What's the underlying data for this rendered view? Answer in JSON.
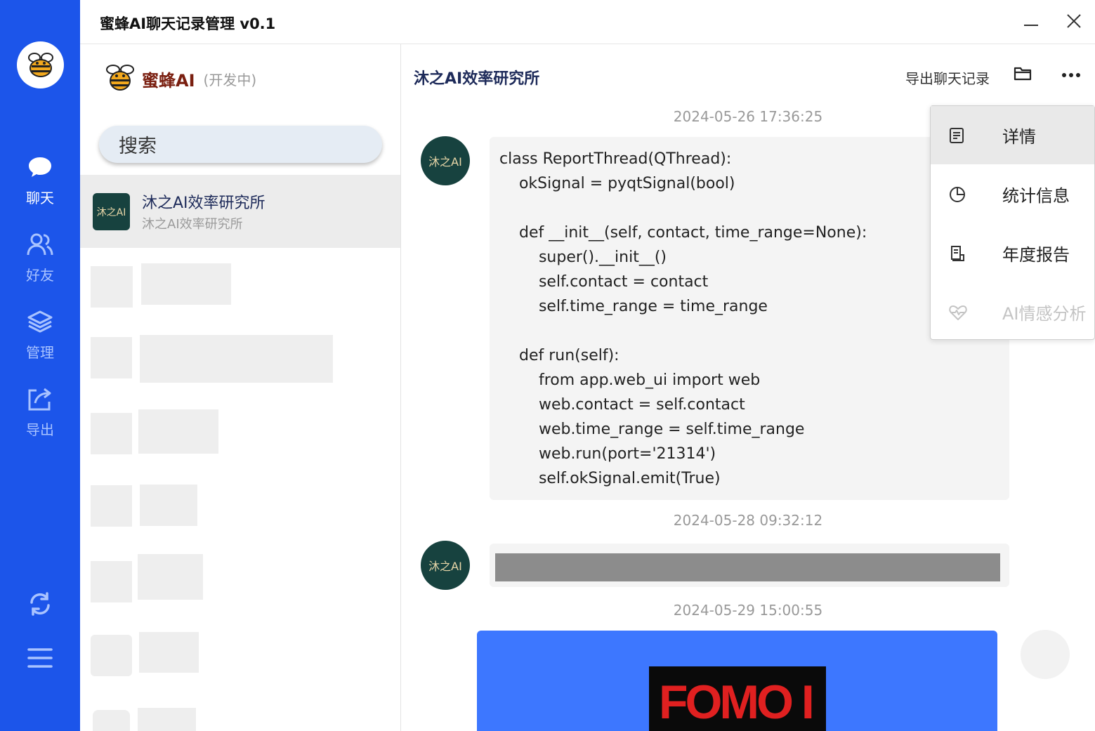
{
  "app": {
    "title": "蜜蜂AI聊天记录管理 v0.1"
  },
  "nav": {
    "items": [
      {
        "label": "聊天",
        "icon": "chat-bubble-icon"
      },
      {
        "label": "好友",
        "icon": "friends-icon"
      },
      {
        "label": "管理",
        "icon": "layers-icon"
      },
      {
        "label": "导出",
        "icon": "share-export-icon"
      }
    ],
    "bottom": [
      "refresh-icon",
      "menu-icon"
    ]
  },
  "brand": {
    "name": "蜜蜂AI",
    "status": "(开发中)"
  },
  "search": {
    "placeholder": "搜索"
  },
  "contacts": [
    {
      "name": "沐之AI效率研究所",
      "last_message": "沐之AI效率研究所",
      "avatar_text": "沐之AI"
    }
  ],
  "chat": {
    "contact_name": "沐之AI效率研究所",
    "export_label": "导出聊天记录",
    "messages": [
      {
        "time": "2024-05-26 17:36:25",
        "avatar_text": "沐之AI",
        "code": "class ReportThread(QThread):\n    okSignal = pyqtSignal(bool)\n\n    def __init__(self, contact, time_range=None):\n        super().__init__()\n        self.contact = contact\n        self.time_range = time_range\n\n    def run(self):\n        from app.web_ui import web\n        web.contact = self.contact\n        web.time_range = self.time_range\n        web.run(port='21314')\n        self.okSignal.emit(True)"
      },
      {
        "time": "2024-05-28 09:32:12",
        "avatar_text": "沐之AI"
      },
      {
        "time": "2024-05-29 15:00:55",
        "image_text": "FOMO I"
      }
    ]
  },
  "menu": {
    "items": [
      {
        "label": "详情",
        "icon": "document-icon",
        "state": "hover"
      },
      {
        "label": "统计信息",
        "icon": "pie-chart-icon",
        "state": "normal"
      },
      {
        "label": "年度报告",
        "icon": "report-icon",
        "state": "normal"
      },
      {
        "label": "AI情感分析",
        "icon": "heart-pulse-icon",
        "state": "disabled"
      }
    ]
  },
  "colors": {
    "nav_bg": "#1c55ea",
    "image_bg": "#3d77ff",
    "avatar_bg": "#17423f",
    "fomo_red": "#e02020"
  }
}
